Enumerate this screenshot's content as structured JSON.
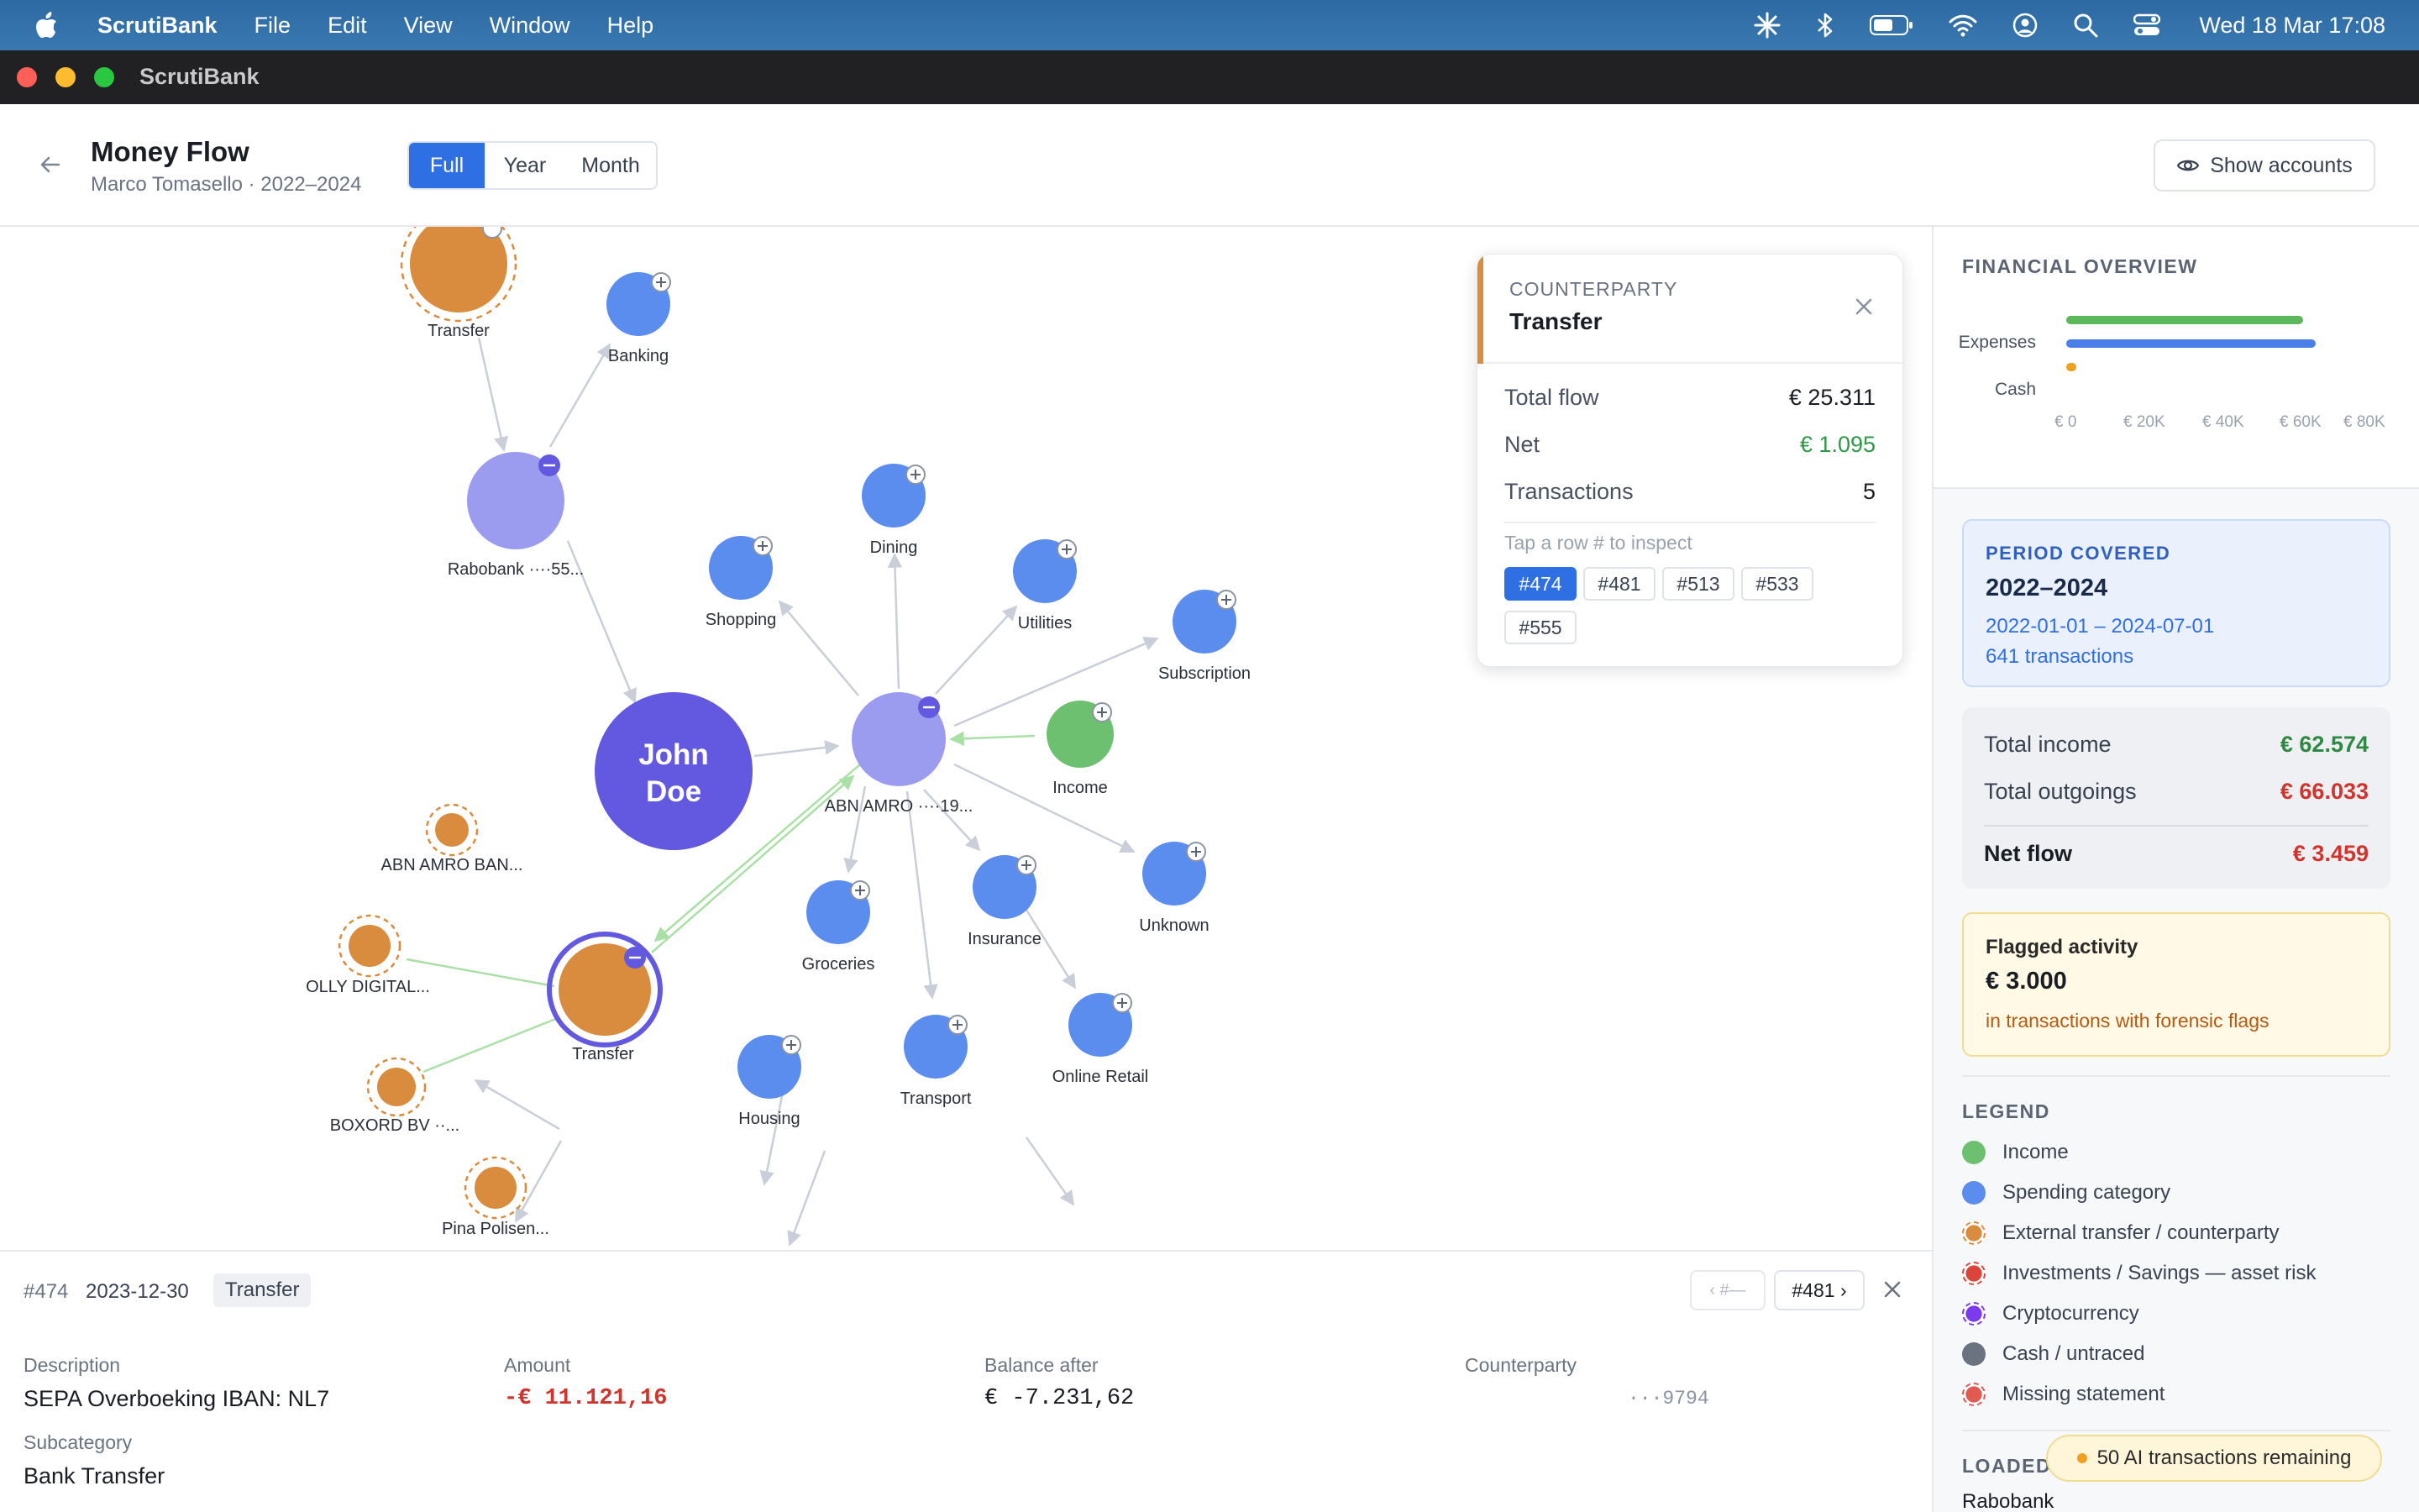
{
  "menubar": {
    "app_name": "ScrutiBank",
    "items": [
      "File",
      "Edit",
      "View",
      "Window",
      "Help"
    ],
    "clock": "Wed 18 Mar  17:08"
  },
  "window": {
    "title": "ScrutiBank"
  },
  "header": {
    "title": "Money Flow",
    "subtitle": "Marco Tomasello · 2022–2024",
    "segments": [
      "Full",
      "Year",
      "Month"
    ],
    "active_segment": "Full",
    "show_accounts_label": "Show accounts"
  },
  "graph": {
    "nodes": {
      "transfer_top": "Transfer",
      "banking": "Banking",
      "rabobank": "Rabobank ····55...",
      "dining": "Dining",
      "shopping": "Shopping",
      "utilities": "Utilities",
      "subscription": "Subscription",
      "john_doe_1": "John",
      "john_doe_2": "Doe",
      "abn_amro": "ABN AMRO ····19...",
      "income": "Income",
      "abn_amro_ban": "ABN AMRO BAN...",
      "olly": "OLLY DIGITAL...",
      "transfer_main": "Transfer",
      "boxord": "BOXORD BV ··...",
      "pina": "Pina Polisen...",
      "groceries": "Groceries",
      "insurance": "Insurance",
      "unknown": "Unknown",
      "housing": "Housing",
      "transport": "Transport",
      "online_retail": "Online Retail"
    },
    "colors": {
      "spending": "#5b8def",
      "income": "#6cc070",
      "account": "#9b9cf0",
      "person": "#6359e0",
      "external": "#d98c3e",
      "edge": "#c9ced8",
      "edge_income": "#a9e0a6"
    }
  },
  "counterparty": {
    "kicker": "COUNTERPARTY",
    "name": "Transfer",
    "total_flow_label": "Total flow",
    "total_flow": "€ 25.311",
    "net_label": "Net",
    "net": "€ 1.095",
    "transactions_label": "Transactions",
    "transactions": "5",
    "hint": "Tap a row # to inspect",
    "chips": [
      "#474",
      "#481",
      "#513",
      "#533",
      "#555"
    ],
    "active_chip": "#474"
  },
  "sidebar": {
    "financial_overview_title": "FINANCIAL OVERVIEW",
    "overview": {
      "labels": [
        "Expenses",
        "Cash"
      ],
      "ticks": [
        "€ 0",
        "€ 20K",
        "€ 40K",
        "€ 60K",
        "€ 80K"
      ],
      "series": [
        {
          "label": "Income",
          "value": 62574,
          "color": "#5cb85c"
        },
        {
          "label": "Expenses",
          "value": 66033,
          "color": "#4a7ee8"
        },
        {
          "label": "Cash",
          "value": 1200,
          "color": "#f0a020"
        }
      ],
      "max": 80000
    },
    "period": {
      "kicker": "PERIOD COVERED",
      "years": "2022–2024",
      "range": "2022-01-01 – 2024-07-01",
      "count": "641 transactions"
    },
    "totals": {
      "income_label": "Total income",
      "income": "€ 62.574",
      "outgoings_label": "Total outgoings",
      "outgoings": "€ 66.033",
      "net_label": "Net flow",
      "net": "€ 3.459"
    },
    "flagged": {
      "title": "Flagged activity",
      "amount": "€ 3.000",
      "subtitle": "in transactions with forensic flags"
    },
    "legend_title": "LEGEND",
    "legend": [
      {
        "label": "Income",
        "color": "#6cc070",
        "style": "solid"
      },
      {
        "label": "Spending category",
        "color": "#5b8def",
        "style": "solid"
      },
      {
        "label": "External transfer / counterparty",
        "color": "#d98c3e",
        "style": "dashed"
      },
      {
        "label": "Investments / Savings — asset risk",
        "color": "#d9453b",
        "style": "dashed"
      },
      {
        "label": "Cryptocurrency",
        "color": "#7c3aed",
        "style": "dashed"
      },
      {
        "label": "Cash / untraced",
        "color": "#6b7280",
        "style": "solid"
      },
      {
        "label": "Missing statement",
        "color": "#e05a52",
        "style": "dashed"
      }
    ],
    "loaded_title": "LOADED",
    "loaded_first": "Rabobank",
    "ai_pill": "50 AI transactions remaining"
  },
  "transaction": {
    "id": "#474",
    "date": "2023-12-30",
    "tag": "Transfer",
    "prev_label": "‹ #—",
    "next_label": "#481 ›",
    "description_label": "Description",
    "description": "SEPA Overboeking IBAN: NL7",
    "amount_label": "Amount",
    "amount": "-€ 11.121,16",
    "balance_label": "Balance after",
    "balance": "€ -7.231,62",
    "counterparty_label": "Counterparty",
    "counterparty": "···9794",
    "subcategory_label": "Subcategory",
    "subcategory": "Bank Transfer"
  }
}
